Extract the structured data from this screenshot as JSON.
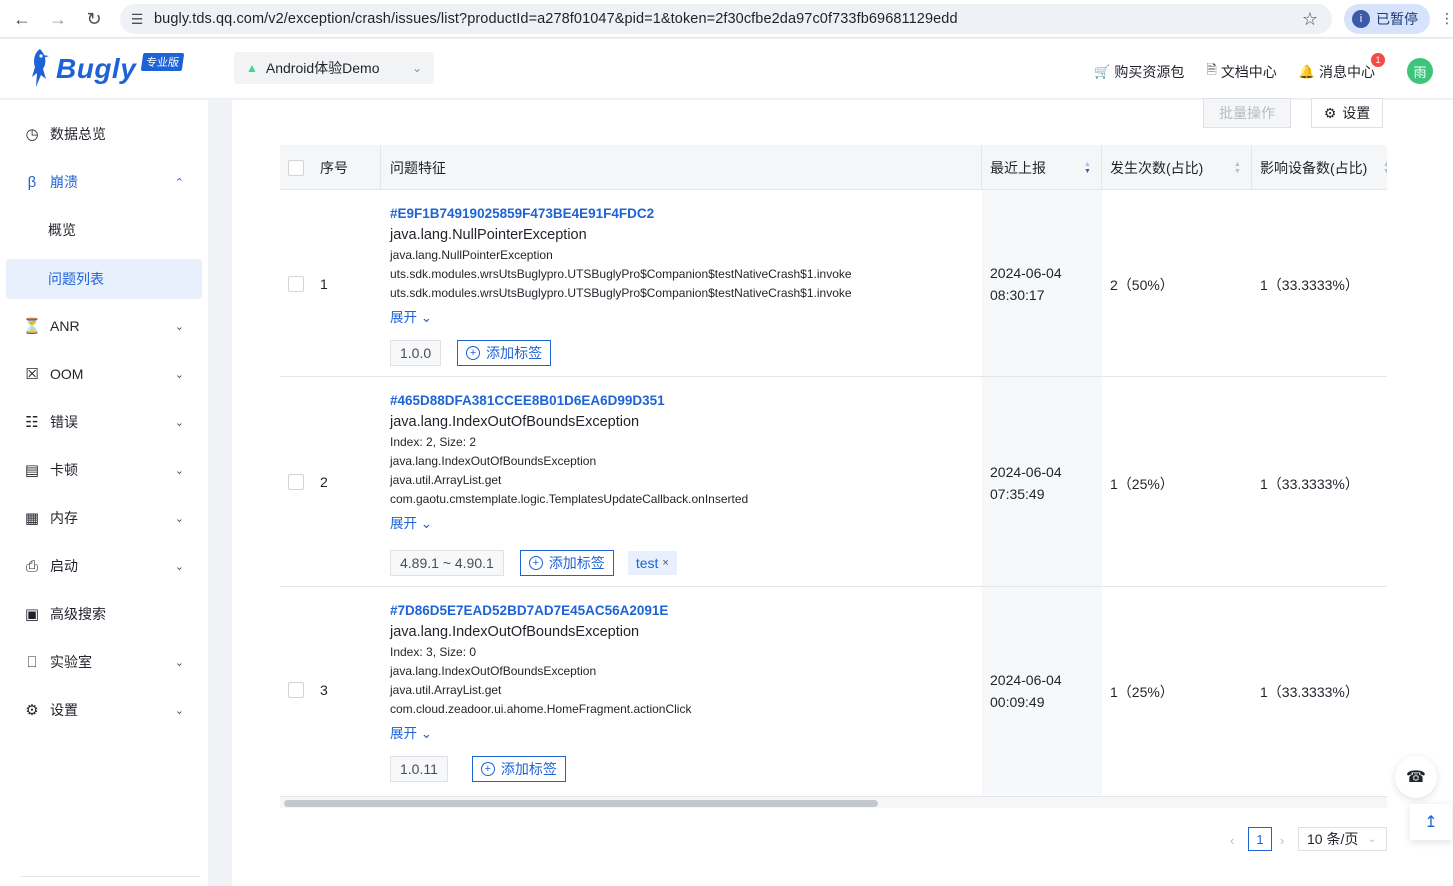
{
  "browser": {
    "url": "bugly.tds.qq.com/v2/exception/crash/issues/list?productId=a278f01047&pid=1&token=2f30cfbe2da97c0f733fb69681129edd",
    "paused_label": "已暂停",
    "paused_initial": "i"
  },
  "header": {
    "logo_text": "Bugly",
    "logo_badge": "专业版",
    "app_name": "Android体验Demo",
    "links": [
      {
        "label": "购买资源包",
        "icon": "cart-icon"
      },
      {
        "label": "文档中心",
        "icon": "document-icon"
      },
      {
        "label": "消息中心",
        "icon": "bell-icon",
        "badge": "1"
      }
    ],
    "avatar_text": "雨"
  },
  "sidebar": {
    "items": [
      {
        "label": "数据总览",
        "icon": "clock-icon"
      },
      {
        "label": "崩溃",
        "icon": "crash-icon",
        "expanded": true
      },
      {
        "label": "概览",
        "sub": true
      },
      {
        "label": "问题列表",
        "sub": true,
        "selected": true
      },
      {
        "label": "ANR",
        "icon": "anr-icon"
      },
      {
        "label": "OOM",
        "icon": "oom-icon"
      },
      {
        "label": "错误",
        "icon": "error-icon"
      },
      {
        "label": "卡顿",
        "icon": "lag-icon"
      },
      {
        "label": "内存",
        "icon": "memory-icon"
      },
      {
        "label": "启动",
        "icon": "launch-icon"
      },
      {
        "label": "高级搜索",
        "icon": "advanced-search-icon"
      },
      {
        "label": "实验室",
        "icon": "lab-icon"
      },
      {
        "label": "设置",
        "icon": "settings-icon"
      }
    ]
  },
  "toolbar": {
    "batch_label": "批量操作",
    "settings_label": "设置"
  },
  "table": {
    "headers": {
      "index": "序号",
      "feature": "问题特征",
      "last_report": "最近上报",
      "occurrences": "发生次数(占比)",
      "devices": "影响设备数(占比)"
    },
    "rows": [
      {
        "index": "1",
        "id": "#E9F1B74919025859F473BE4E91F4FDC2",
        "title": "java.lang.NullPointerException",
        "lines": [
          "java.lang.NullPointerException",
          "uts.sdk.modules.wrsUtsBuglypro.UTSBuglyPro$Companion$testNativeCrash$1.invoke",
          "uts.sdk.modules.wrsUtsBuglypro.UTSBuglyPro$Companion$testNativeCrash$1.invoke"
        ],
        "expand": "展开",
        "version": "1.0.0",
        "add_tag": "添加标签",
        "date": "2024-06-04",
        "time": "08:30:17",
        "occurrences": "2（50%）",
        "devices": "1（33.3333%）"
      },
      {
        "index": "2",
        "id": "#465D88DFA381CCEE8B01D6EA6D99D351",
        "title": "java.lang.IndexOutOfBoundsException",
        "lines": [
          "Index: 2, Size: 2",
          "java.lang.IndexOutOfBoundsException",
          "java.util.ArrayList.get",
          "com.gaotu.cmstemplate.logic.TemplatesUpdateCallback.onInserted"
        ],
        "expand": "展开",
        "version": "4.89.1 ~ 4.90.1",
        "add_tag": "添加标签",
        "custom_tag": "test",
        "date": "2024-06-04",
        "time": "07:35:49",
        "occurrences": "1（25%）",
        "devices": "1（33.3333%）"
      },
      {
        "index": "3",
        "id": "#7D86D5E7EAD52BD7AD7E45AC56A2091E",
        "title": "java.lang.IndexOutOfBoundsException",
        "lines": [
          "Index: 3, Size: 0",
          "java.lang.IndexOutOfBoundsException",
          "java.util.ArrayList.get",
          "com.cloud.zeadoor.ui.ahome.HomeFragment.actionClick"
        ],
        "expand": "展开",
        "version": "1.0.11",
        "add_tag": "添加标签",
        "date": "2024-06-04",
        "time": "00:09:49",
        "occurrences": "1（25%）",
        "devices": "1（33.3333%）"
      }
    ]
  },
  "pagination": {
    "current_page": "1",
    "page_size": "10 条/页"
  },
  "colors": {
    "accent": "#1e63d6",
    "avatar": "#3fc57b",
    "badge": "#f54a45"
  }
}
